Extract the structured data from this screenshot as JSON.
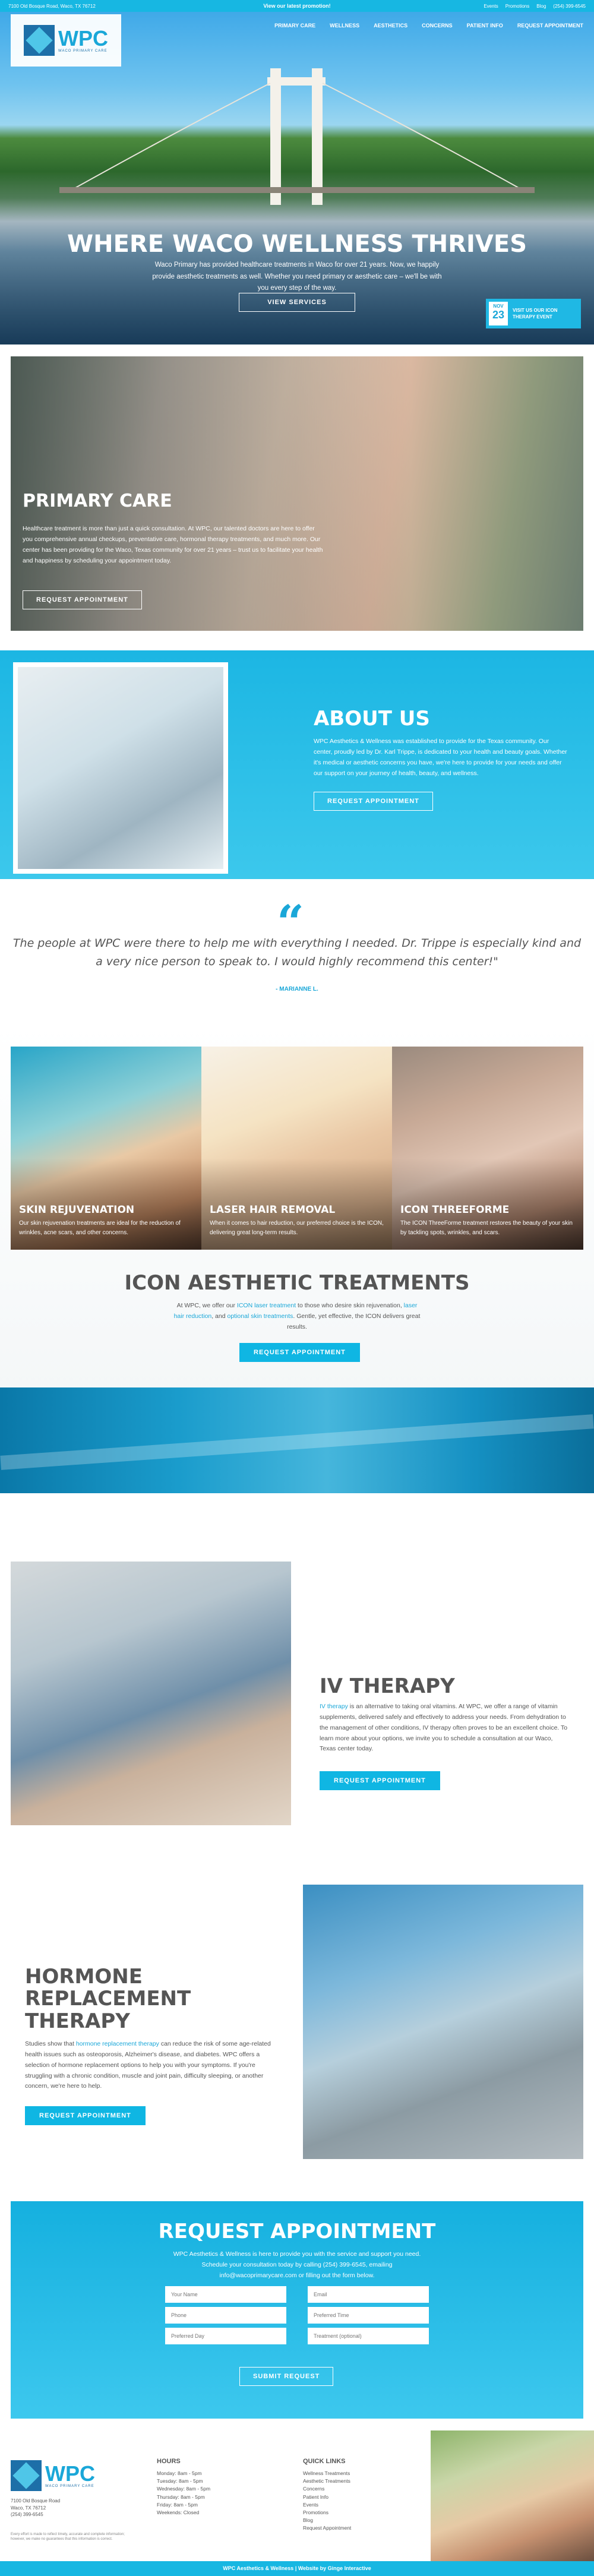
{
  "topbar": {
    "address": "7100 Old Bosque Road, Waco, TX 76712",
    "promo": "View our latest promotion!",
    "links": [
      "Events",
      "Promotions",
      "Blog",
      "(254) 399-6545"
    ]
  },
  "logo": {
    "text": "WPC",
    "sub": "WACO PRIMARY CARE"
  },
  "nav": [
    "PRIMARY CARE",
    "WELLNESS",
    "AESTHETICS",
    "CONCERNS",
    "PATIENT INFO",
    "REQUEST APPOINTMENT"
  ],
  "hero": {
    "title": "WHERE WACO WELLNESS THRIVES",
    "text": "Waco Primary has provided healthcare treatments in Waco for over 21 years. Now, we happily provide aesthetic treatments as well. Whether you need primary or aesthetic care – we'll be with you every step of the way.",
    "button": "VIEW SERVICES",
    "event_month": "NOV",
    "event_day": "23",
    "event_text": "Visit Us Our ICON THERAPY EVENT"
  },
  "primary_care": {
    "title": "PRIMARY CARE",
    "text": "Healthcare treatment is more than just a quick consultation. At WPC, our talented doctors are here to offer you comprehensive annual checkups, preventative care, hormonal therapy treatments, and much more. Our center has been providing for the Waco, Texas community for over 21 years – trust us to facilitate your health and happiness by scheduling your appointment today.",
    "button": "REQUEST APPOINTMENT"
  },
  "about": {
    "title": "ABOUT US",
    "text": "WPC Aesthetics & Wellness was established to provide for the Texas community. Our center, proudly led by Dr. Karl Trippe, is dedicated to your health and beauty goals. Whether it's medical or aesthetic concerns you have, we're here to provide for your needs and offer our support on your journey of health, beauty, and wellness.",
    "button": "REQUEST APPOINTMENT"
  },
  "testimonial": {
    "quote_mark": "“",
    "text": "The people at WPC were there to help me with everything I needed. Dr. Trippe is especially kind and a very nice person to speak to. I would highly recommend this center!\"",
    "author": "- MARIANNE L."
  },
  "aesthetics": {
    "cards": [
      {
        "title": "SKIN REJUVENATION",
        "text": "Our skin rejuvenation treatments are ideal for the reduction of wrinkles, acne scars, and other concerns."
      },
      {
        "title": "LASER HAIR REMOVAL",
        "text": "When it comes to hair reduction, our preferred choice is the ICON, delivering great long-term results."
      },
      {
        "title": "ICON THREEFORME",
        "text": "The ICON ThreeForme treatment restores the beauty of your skin by tackling spots, wrinkles, and scars."
      }
    ],
    "title": "ICON AESTHETIC TREATMENTS",
    "text_a": "At WPC, we offer our",
    "link_1": "ICON laser treatment",
    "text_b": "to those who desire skin rejuvenation,",
    "link_2": "laser hair reduction",
    "text_c": ", and",
    "link_3": "optional skin treatments",
    "text_d": ". Gentle, yet effective, the ICON delivers great results.",
    "button": "REQUEST APPOINTMENT"
  },
  "iv": {
    "title": "IV THERAPY",
    "link": "IV therapy",
    "text": "is an alternative to taking oral vitamins. At WPC, we offer a range of vitamin supplements, delivered safely and effectively to address your needs. From dehydration to the management of other conditions, IV therapy often proves to be an excellent choice. To learn more about your options, we invite you to schedule a consultation at our Waco, Texas center today.",
    "button": "REQUEST APPOINTMENT"
  },
  "hrt": {
    "title_1": "HORMONE",
    "title_2": "REPLACEMENT",
    "title_3": "THERAPY",
    "text_a": "Studies show that",
    "link": "hormone replacement therapy",
    "text_b": "can reduce the risk of some age-related health issues such as osteoporosis, Alzheimer's disease, and diabetes. WPC offers a selection of hormone replacement options to help you with your symptoms. If you're struggling with a chronic condition, muscle and joint pain, difficulty sleeping, or another concern, we're here to help.",
    "button": "REQUEST APPOINTMENT"
  },
  "request": {
    "title": "REQUEST APPOINTMENT",
    "text": "WPC Aesthetics & Wellness is here to provide you with the service and support you need. Schedule your consultation today by calling (254) 399-6545, emailing info@wacoprimarycare.com or filling out the form below.",
    "fields": [
      "Your Name",
      "Email",
      "Phone",
      "Preferred Time",
      "Preferred Day",
      "Treatment (optional)"
    ],
    "button": "SUBMIT REQUEST"
  },
  "footer": {
    "address": "7100 Old Bosque Road\nWaco, TX 76712\n(254) 399-6545",
    "note": "Every effort is made to reflect timely, accurate and complete information; however, we make no guarantees that this information is correct.",
    "hours_title": "HOURS",
    "hours": [
      "Monday: 8am - 5pm",
      "Tuesday: 8am - 5pm",
      "Wednesday: 8am - 5pm",
      "Thursday: 8am - 5pm",
      "Friday: 8am - 5pm",
      "Weekends: Closed"
    ],
    "ql_title": "QUICK LINKS",
    "quick_links": [
      "Wellness Treatments",
      "Aesthetic Treatments",
      "Concerns",
      "Patient Info",
      "Events",
      "Promotions",
      "Blog",
      "Request Appointment"
    ],
    "copyright": "WPC Aesthetics & Wellness | Website by Ginge Interactive"
  }
}
